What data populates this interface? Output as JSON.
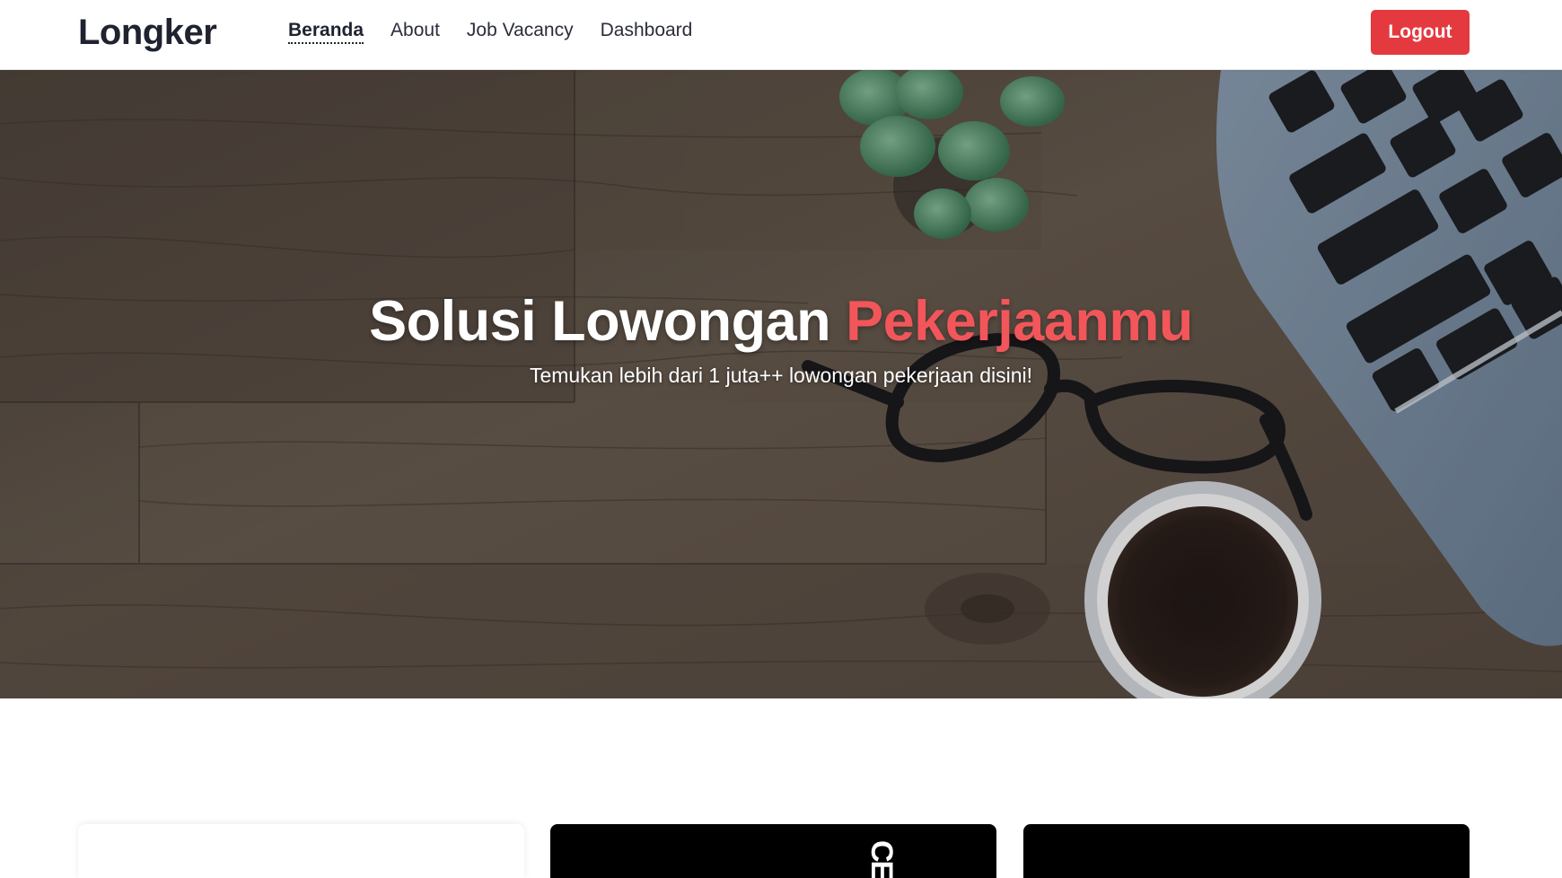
{
  "navbar": {
    "brand": "Longker",
    "links": [
      {
        "label": "Beranda",
        "active": true
      },
      {
        "label": "About",
        "active": false
      },
      {
        "label": "Job Vacancy",
        "active": false
      },
      {
        "label": "Dashboard",
        "active": false
      }
    ],
    "logout_label": "Logout"
  },
  "hero": {
    "title_main": "Solusi Lowongan ",
    "title_accent": "Pekerjaanmu",
    "subtitle": "Temukan lebih dari 1 juta++ lowongan pekerjaan disini!"
  },
  "cards": {
    "card2_mark": "CE"
  },
  "colors": {
    "accent": "#f2565a",
    "logout_button": "#e43a3f",
    "text_dark": "#1f2330"
  }
}
